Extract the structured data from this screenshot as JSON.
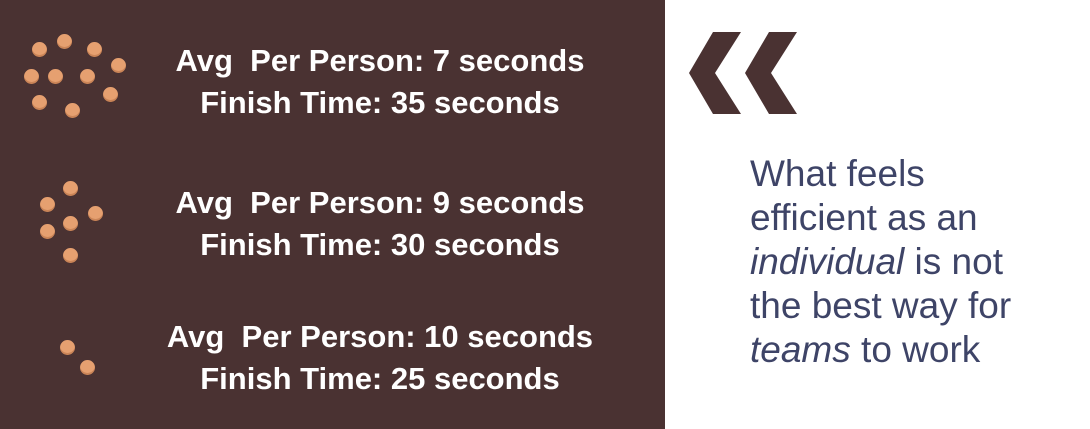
{
  "colors": {
    "panel_background": "#4a3232",
    "dot": "#e6a070",
    "quote_text": "#3e4467",
    "quote_mark": "#4a3232"
  },
  "rows": [
    {
      "avg_line": "Avg  Per Person: 7 seconds",
      "finish_line": "Finish Time: 35 seconds"
    },
    {
      "avg_line": "Avg  Per Person: 9 seconds",
      "finish_line": "Finish Time: 30 seconds"
    },
    {
      "avg_line": "Avg  Per Person: 10 seconds",
      "finish_line": "Finish Time: 25 seconds"
    }
  ],
  "quote": {
    "line1": "What feels",
    "line2": "efficient as an",
    "line3_emphasis": "individual",
    "line3_rest": " is not",
    "line4": "the best way for",
    "line5_emphasis": "teams",
    "line5_rest": " to work"
  },
  "icons": {
    "quote_mark": "left-double-angle-quote-icon"
  }
}
